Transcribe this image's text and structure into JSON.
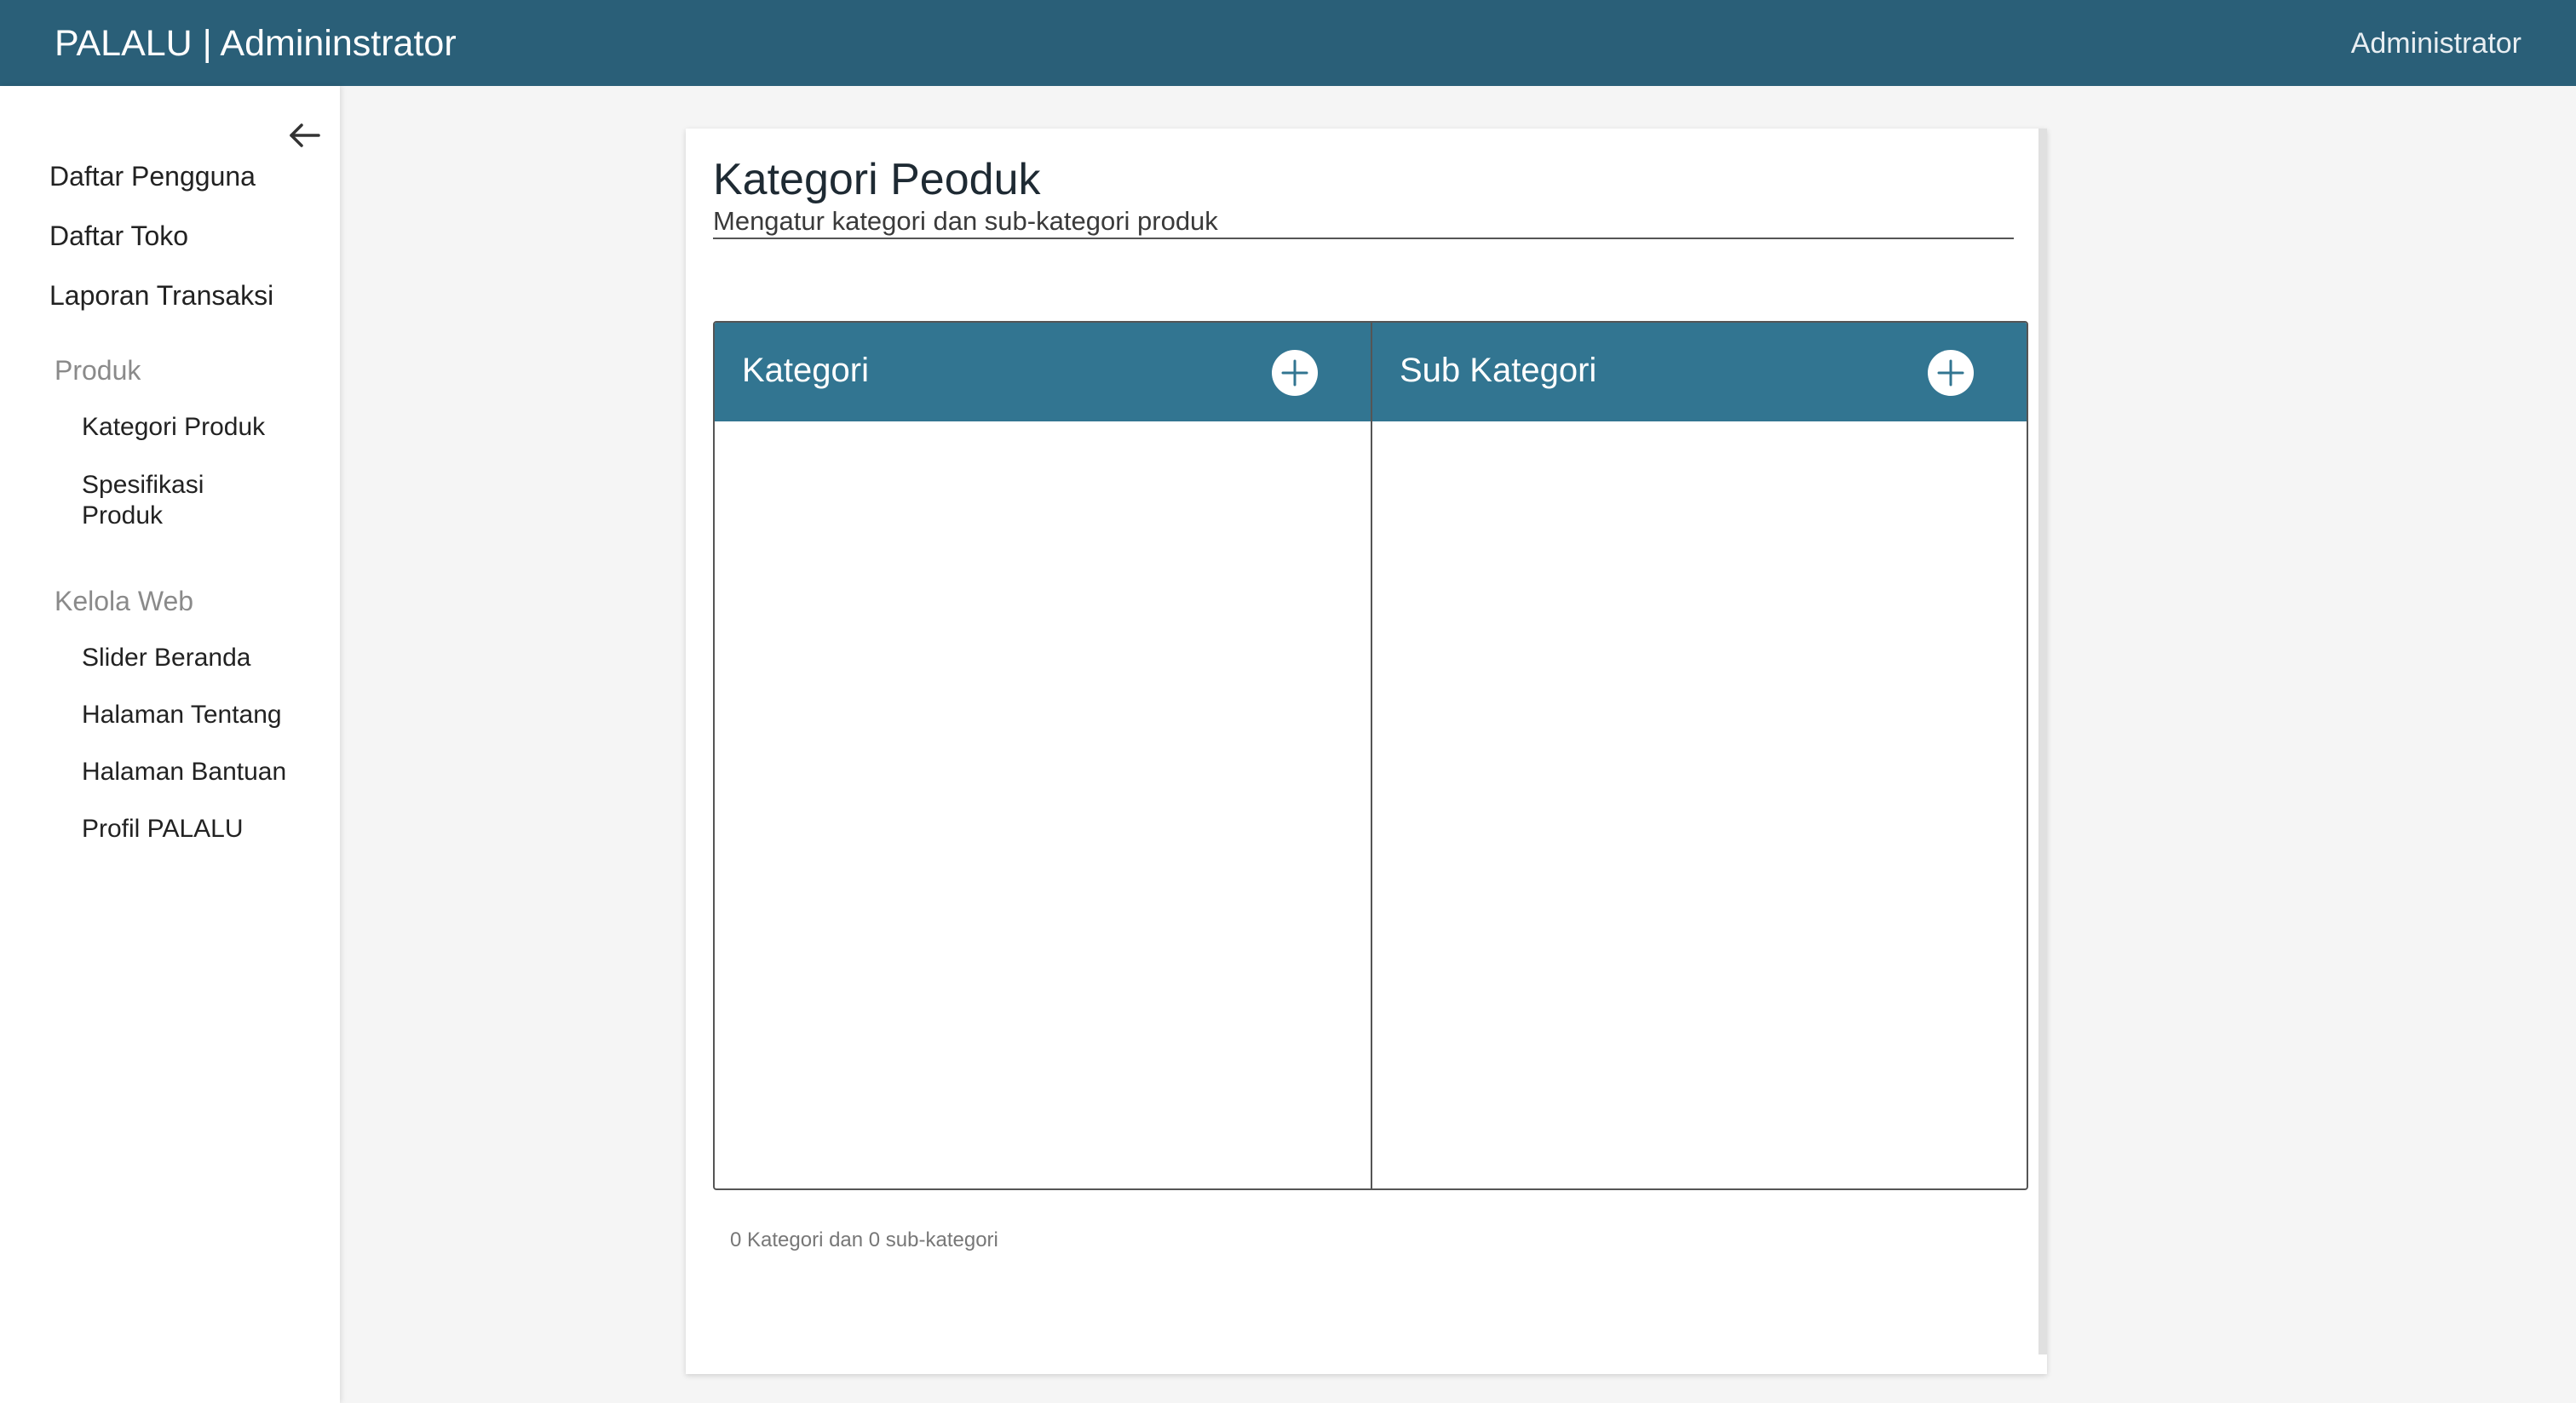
{
  "header": {
    "app_title": "PALALU | Admininstrator",
    "user_name": "Administrator"
  },
  "sidebar": {
    "collapse_icon": "arrow-left-icon",
    "top_items": [
      {
        "label": "Daftar Pengguna"
      },
      {
        "label": "Daftar Toko"
      },
      {
        "label": "Laporan Transaksi"
      }
    ],
    "sections": [
      {
        "title": "Produk",
        "items": [
          {
            "label": "Kategori Produk"
          },
          {
            "label": "Spesifikasi Produk"
          }
        ]
      },
      {
        "title": "Kelola Web",
        "items": [
          {
            "label": "Slider Beranda"
          },
          {
            "label": "Halaman Tentang"
          },
          {
            "label": "Halaman Bantuan"
          },
          {
            "label": "Profil PALALU"
          }
        ]
      }
    ]
  },
  "main": {
    "title": "Kategori Peoduk",
    "subtitle": "Mengatur kategori dan sub-kategori produk",
    "panels": [
      {
        "title": "Kategori",
        "add_icon": "plus-circle-icon"
      },
      {
        "title": "Sub Kategori",
        "add_icon": "plus-circle-icon"
      }
    ],
    "summary": "0 Kategori dan 0 sub-kategori"
  },
  "colors": {
    "topbar": "#2a5f78",
    "panel_header": "#327591",
    "background": "#f5f5f5"
  }
}
